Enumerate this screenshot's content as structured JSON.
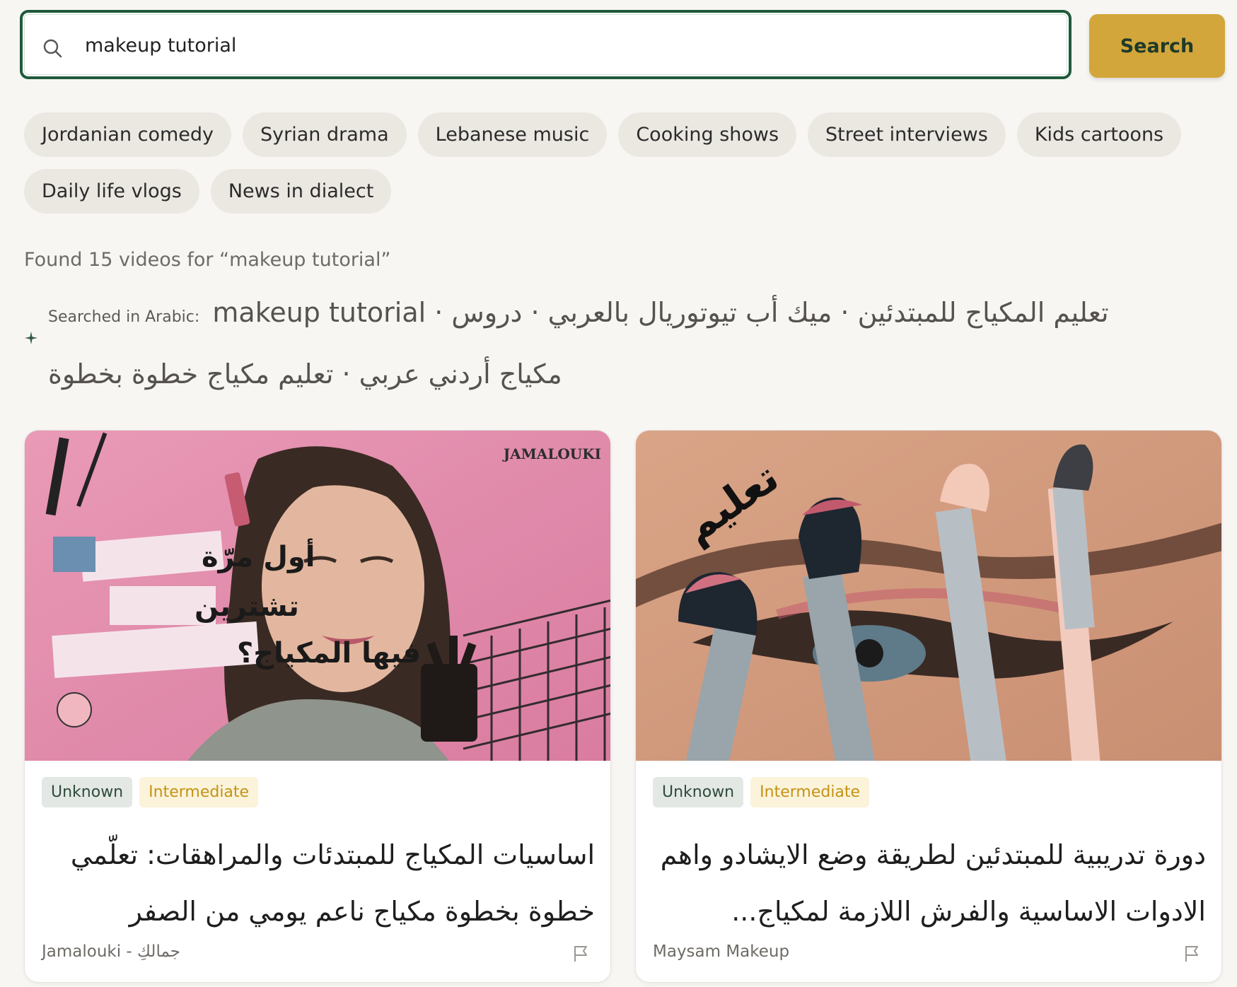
{
  "search": {
    "value": "makeup tutorial",
    "button_label": "Search"
  },
  "chips": [
    "Jordanian comedy",
    "Syrian drama",
    "Lebanese music",
    "Cooking shows",
    "Street interviews",
    "Kids cartoons",
    "Daily life vlogs",
    "News in dialect"
  ],
  "results": {
    "found_text": "Found 15 videos for “makeup tutorial”",
    "arabic_prefix": "Searched in Arabic:",
    "arabic_terms": "makeup tutorial · تعليم المكياج للمبتدئين · ميك أب تيوتوريال بالعربي · دروس مكياج أردني عربي · تعليم مكياج خطوة بخطوة"
  },
  "videos": [
    {
      "badge_origin": "Unknown",
      "badge_level": "Intermediate",
      "title": "اساسيات المكياج للمبتدئات والمراهقات: تعلّمي خطوة بخطوة مكياج ناعم يومي من الصفر",
      "channel": "Jamalouki - جمالكِ",
      "thumb_brand": "JAMALOUKI",
      "thumb_line1": "أول مرّة",
      "thumb_line2": "تشترين",
      "thumb_line3": "فيها المكياج؟"
    },
    {
      "badge_origin": "Unknown",
      "badge_level": "Intermediate",
      "title": "دورة تدريبية للمبتدئين لطريقة وضع الايشادو واهم الادوات الاساسية والفرش اللازمة لمكياج...",
      "channel": "Maysam Makeup",
      "thumb_word": "تعليم"
    }
  ],
  "colors": {
    "accent_green": "#1f5a3c",
    "search_button": "#d2a63a",
    "chip_bg": "#ebe8e2",
    "level_badge_text": "#c59216"
  }
}
